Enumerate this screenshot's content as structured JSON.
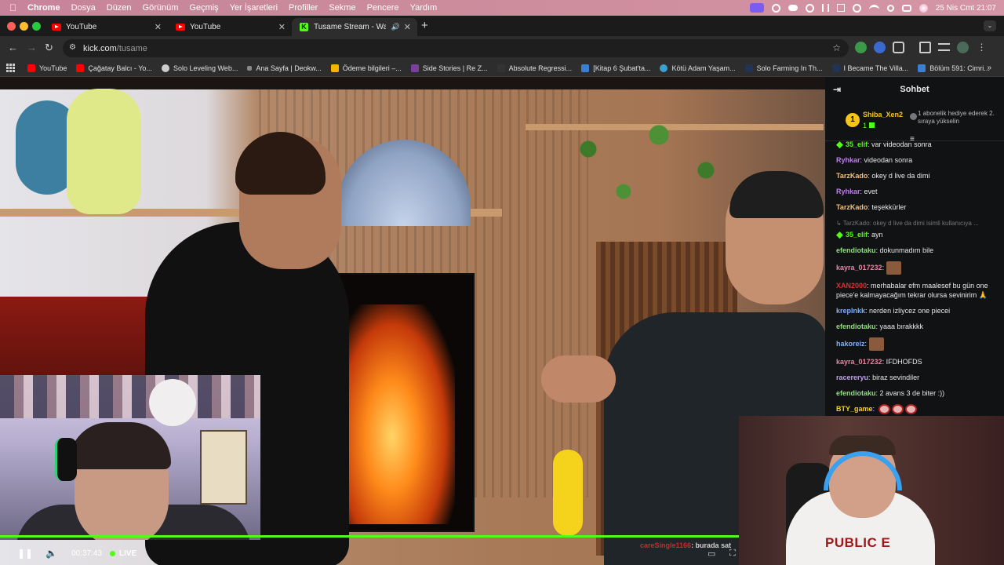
{
  "menubar": {
    "app": "Chrome",
    "items": [
      "Dosya",
      "Düzen",
      "Görünüm",
      "Geçmiş",
      "Yer İşaretleri",
      "Profiller",
      "Sekme",
      "Pencere",
      "Yardım"
    ],
    "clock": "25 Nis Cmt  21:07"
  },
  "tabs": [
    {
      "title": "YouTube",
      "active": false
    },
    {
      "title": "YouTube",
      "active": false
    },
    {
      "title": "Tusame Stream - Watch L",
      "active": true
    }
  ],
  "omnibox": {
    "domain": "kick.com",
    "path": "/tusame"
  },
  "bookmarks": [
    {
      "label": "YouTube",
      "color": "#ff0000"
    },
    {
      "label": "Çağatay Balcı - Yo...",
      "color": "#ff0000"
    },
    {
      "label": "Solo Leveling Web...",
      "color": "#cccccc"
    },
    {
      "label": "Ana Sayfa | Deokw...",
      "color": "#888888"
    },
    {
      "label": "Ödeme bilgileri –...",
      "color": "#f4b400"
    },
    {
      "label": "Side Stories | Re Z...",
      "color": "#7b3fa0"
    },
    {
      "label": "Absolute Regressi...",
      "color": "#333333"
    },
    {
      "label": "[Kitap 6 Şubat'ta...",
      "color": "#3a80d0"
    },
    {
      "label": "Kötü Adam Yaşam...",
      "color": "#3aa0d0"
    },
    {
      "label": "Solo Farming In Th...",
      "color": "#223355"
    },
    {
      "label": "I Became The Villa...",
      "color": "#223355"
    },
    {
      "label": "Bölüm 591: Cimri...",
      "color": "#3a80d0"
    }
  ],
  "player": {
    "time": "00:37:43",
    "live": "LIVE",
    "caption_user": "careSingle1166",
    "caption_text": ": burada sat"
  },
  "chat": {
    "title": "Sohbet",
    "pinned": {
      "rank": "1",
      "name": "Shiba_Xen2",
      "count": "1",
      "gift_text": "1 abonelik hediye ederek 2. sıraya yükselin"
    },
    "messages": [
      {
        "user": "35_elif",
        "color": "#53fc18",
        "text": "var videodan sonra"
      },
      {
        "user": "Ryhkar",
        "color": "#c27ef0",
        "text": "videodan sonra"
      },
      {
        "user": "TarzKado",
        "color": "#f0c080",
        "text": "okey d live da dimi"
      },
      {
        "user": "Ryhkar",
        "color": "#c27ef0",
        "text": "evet"
      },
      {
        "user": "TarzKado",
        "color": "#f0c080",
        "text": "teşekkürler"
      },
      {
        "user": "",
        "color": "#777777",
        "text": "TarzKado: okey d live da dimi isimli kullanıcıya ..."
      },
      {
        "user": "35_elif",
        "color": "#53fc18",
        "text": "ayn"
      },
      {
        "user": "efendiotaku",
        "color": "#8fe07a",
        "text": "dokunmadım bile"
      },
      {
        "user": "kayra_017232",
        "color": "#f080a0",
        "text": ""
      },
      {
        "user": "XAN2000",
        "color": "#e03030",
        "text": "merhabalar efm maalesef bu gün one piece'e kalmayacağım tekrar olursa sevinirim 🙏"
      },
      {
        "user": "krepInkk",
        "color": "#7fb0f0",
        "text": "nerden izliycez one piecei"
      },
      {
        "user": "efendiotaku",
        "color": "#8fe07a",
        "text": "yaaa bırakkkk"
      },
      {
        "user": "hakoreiz",
        "color": "#7fb0f0",
        "text": ""
      },
      {
        "user": "kayra_017232",
        "color": "#f080a0",
        "text": "IFDHOFDS"
      },
      {
        "user": "racereryu",
        "color": "#c0a0f0",
        "text": "biraz sevindiler"
      },
      {
        "user": "efendiotaku",
        "color": "#8fe07a",
        "text": "2 avans 3 de biter :))"
      },
      {
        "user": "BTY_game",
        "color": "#f5d21c",
        "text": ""
      }
    ]
  }
}
